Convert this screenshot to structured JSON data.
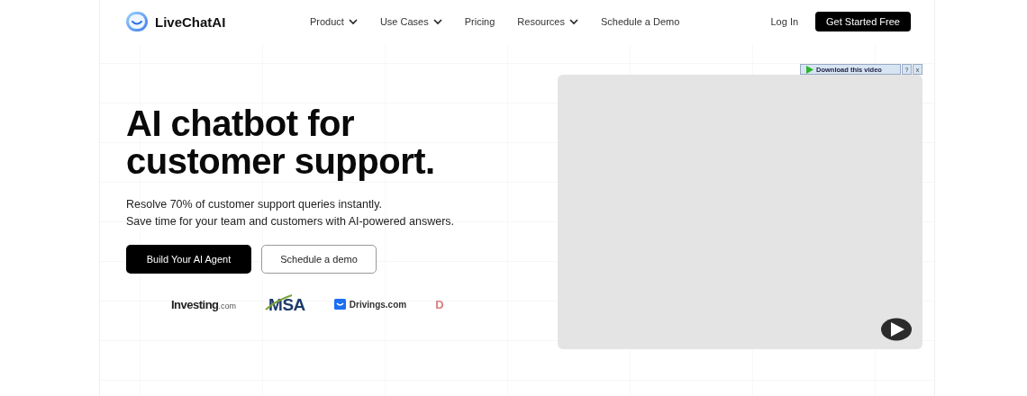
{
  "header": {
    "brand": "LiveChatAI",
    "nav": [
      {
        "label": "Product",
        "dropdown": true
      },
      {
        "label": "Use Cases",
        "dropdown": true
      },
      {
        "label": "Pricing",
        "dropdown": false
      },
      {
        "label": "Resources",
        "dropdown": true
      },
      {
        "label": "Schedule a Demo",
        "dropdown": false
      }
    ],
    "login": "Log In",
    "cta": "Get Started Free"
  },
  "hero": {
    "title_lines": [
      "AI chatbot for",
      "customer support."
    ],
    "subtitle_lines": [
      "Resolve 70% of customer support queries instantly.",
      "Save time for your team and customers with AI-powered answers."
    ],
    "buttons": [
      {
        "label": "Build Your AI Agent",
        "kind": "primary"
      },
      {
        "label": "Schedule a demo",
        "kind": "secondary"
      }
    ],
    "logos": [
      {
        "kind": "investing",
        "name": "Investing",
        "suffix": ".com"
      },
      {
        "kind": "msa",
        "name": "MSA"
      },
      {
        "kind": "drivings",
        "name": "Drivings.com"
      },
      {
        "kind": "faded",
        "name": "D"
      }
    ]
  },
  "video": {
    "download_bar": {
      "label": "Download this video",
      "help": "?",
      "close": "x"
    }
  }
}
